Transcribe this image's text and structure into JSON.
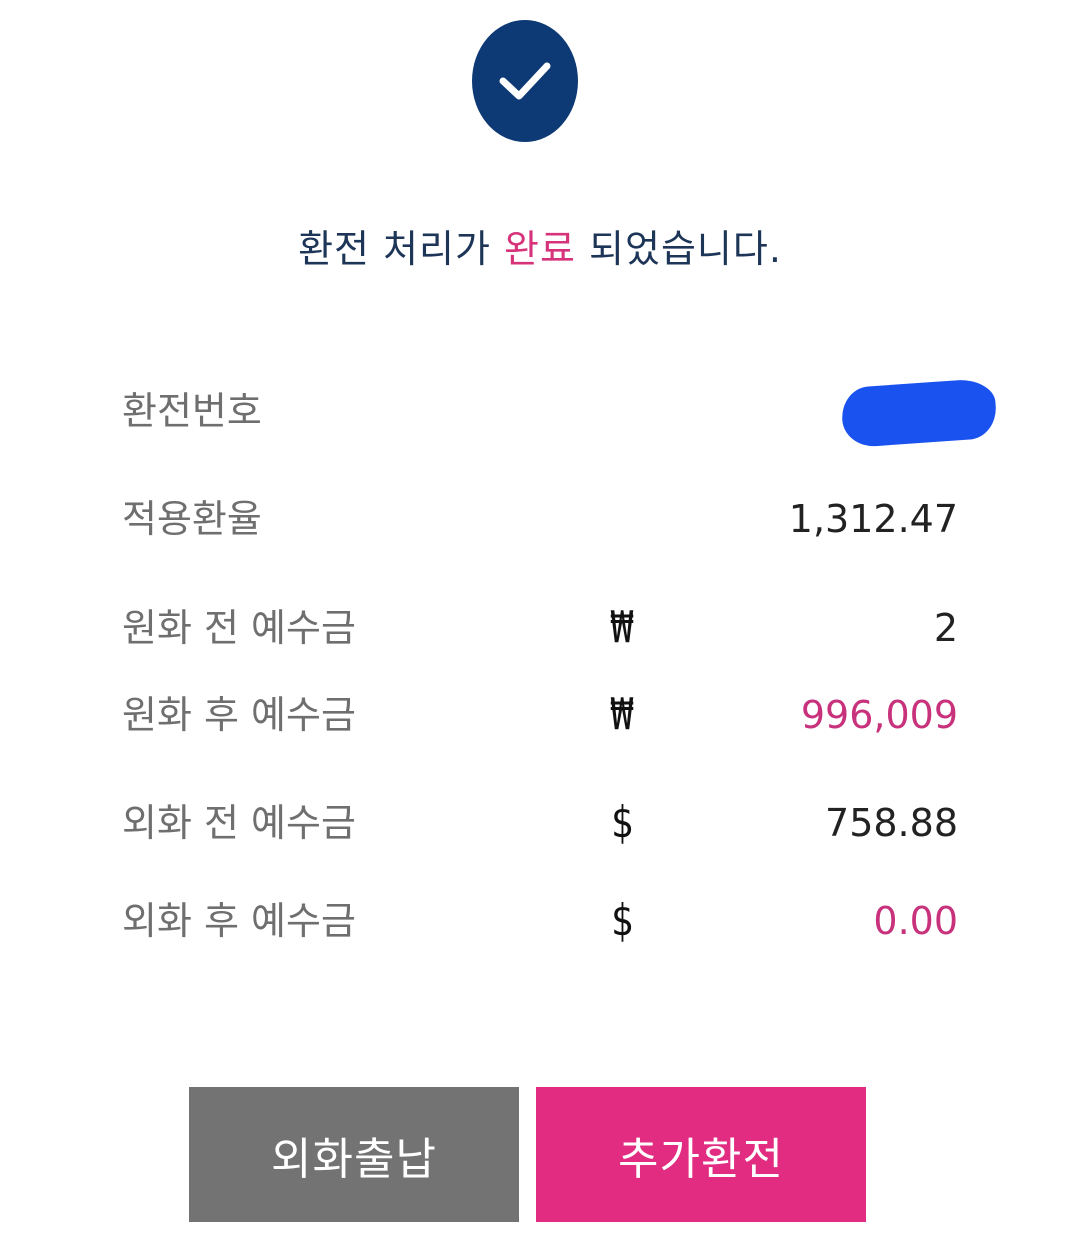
{
  "headline": {
    "part1": "환전 처리가 ",
    "accent": "완료",
    "part2": " 되었습니다."
  },
  "details": {
    "exchange_number": {
      "label": "환전번호",
      "value": ""
    },
    "applied_rate": {
      "label": "적용환율",
      "value": "1,312.47"
    },
    "krw_before": {
      "label": "원화 전 예수금",
      "currency": "₩",
      "value": "2"
    },
    "krw_after": {
      "label": "원화 후 예수금",
      "currency": "₩",
      "value": "996,009"
    },
    "fx_before": {
      "label": "외화 전 예수금",
      "currency": "$",
      "value": "758.88"
    },
    "fx_after": {
      "label": "외화 후 예수금",
      "currency": "$",
      "value": "0.00"
    }
  },
  "buttons": {
    "fx_transfer": "외화출납",
    "add_exchange": "추가환전"
  },
  "colors": {
    "primary_navy": "#0d3a75",
    "accent_pink": "#e12c82",
    "value_pink": "#c8317b",
    "button_gray": "#737373",
    "redaction_blue": "#1a52f0"
  },
  "icons": {
    "status": "check-icon"
  }
}
